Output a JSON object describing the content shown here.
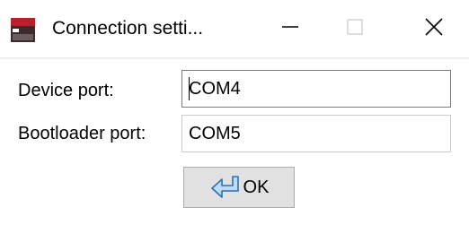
{
  "window": {
    "title": "Connection setti...",
    "controls": {
      "minimize_icon": "minimize-icon",
      "maximize_icon": "maximize-icon",
      "close_icon": "close-icon"
    },
    "app_icon": "app-window-icon"
  },
  "form": {
    "device_port_label": "Device port:",
    "device_port_value": "COM4",
    "bootloader_port_label": "Bootloader port:",
    "bootloader_port_value": "COM5"
  },
  "buttons": {
    "ok_label": "OK",
    "ok_icon": "enter-arrow-icon"
  },
  "colors": {
    "title_bar_background": "#ffffff",
    "button_background": "#e1e1e1",
    "field_border_active": "#7a7a7a",
    "field_border_inactive": "#cccccc",
    "icon_blue": "#3a8fd8"
  }
}
